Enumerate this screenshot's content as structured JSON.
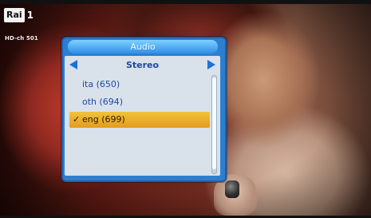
{
  "channel": {
    "logo_text": "Rai",
    "logo_number": "1",
    "tag": "HD-ch 501"
  },
  "audio_dialog": {
    "title": "Audio",
    "mode": "Stereo",
    "tracks": [
      {
        "label": "ita (650)",
        "selected": false
      },
      {
        "label": "oth (694)",
        "selected": false
      },
      {
        "label": "eng (699)",
        "selected": true
      }
    ]
  },
  "icons": {
    "left": "chevron-left-icon",
    "right": "chevron-right-icon",
    "check": "checkmark-icon"
  },
  "colors": {
    "dialog_blue": "#2c7fd0",
    "selection_orange": "#e59b1f",
    "text_blue": "#1d4aa6"
  }
}
